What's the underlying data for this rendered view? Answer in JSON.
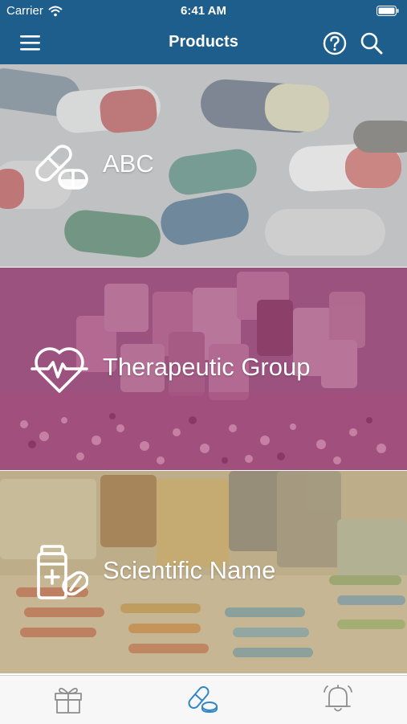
{
  "status_bar": {
    "carrier": "Carrier",
    "time": "6:41 AM"
  },
  "nav": {
    "title": "Products",
    "left_icon": "menu-icon",
    "right_icons": [
      "help-icon",
      "search-icon"
    ]
  },
  "categories": [
    {
      "label": "ABC",
      "icon": "capsules-icon",
      "overlay_color": "#c8c8c8"
    },
    {
      "label": "Therapeutic Group",
      "icon": "heart-pulse-icon",
      "overlay_color": "#a0467a"
    },
    {
      "label": "Scientific Name",
      "icon": "medicine-bottle-icon",
      "overlay_color": "#c9b891"
    }
  ],
  "tab_bar": {
    "tabs": [
      {
        "icon": "gift-icon",
        "active": false
      },
      {
        "icon": "pills-icon",
        "active": true
      },
      {
        "icon": "bell-icon",
        "active": false
      }
    ]
  },
  "colors": {
    "brand": "#1d5e8c",
    "tab_active": "#2f86c8",
    "tab_inactive": "#8e8e8e"
  }
}
